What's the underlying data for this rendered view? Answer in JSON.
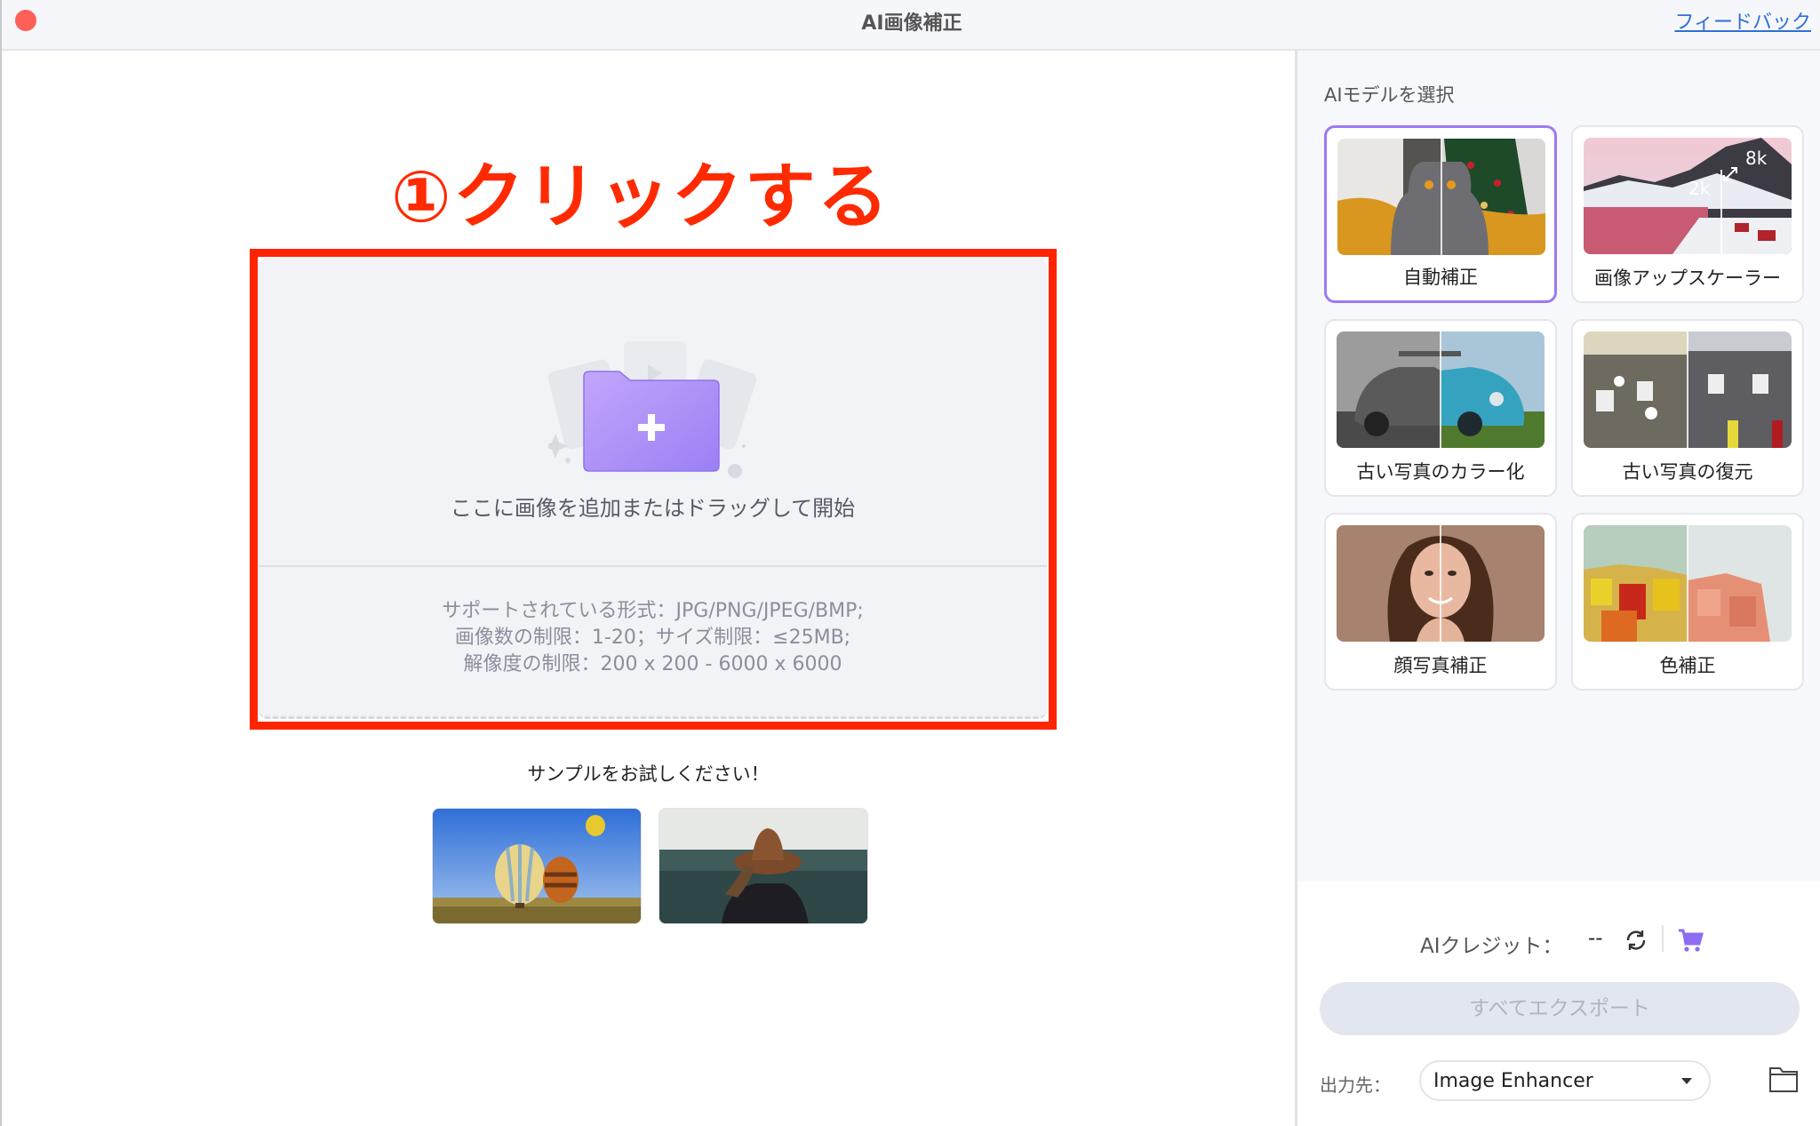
{
  "window": {
    "title": "AI画像補正",
    "feedback_link": "フィードバック",
    "close_button_color": "#fe5f57"
  },
  "annotation": {
    "text": "①クリックする",
    "color": "#ff2a00"
  },
  "dropzone": {
    "prompt": "ここに画像を追加またはドラッグして開始",
    "icon": "folder-plus-icon",
    "specs": [
      "サポートされている形式：JPG/PNG/JPEG/BMP;",
      "画像数の制限：1-20；サイズ制限：≤25MB;",
      "解像度の制限：200 x 200 - 6000 x 6000"
    ]
  },
  "samples": {
    "title": "サンプルをお試しください！",
    "items": [
      {
        "name": "hot-air-balloons"
      },
      {
        "name": "woman-in-hat-forest"
      }
    ]
  },
  "sidebar": {
    "model_label": "AIモデルを選択",
    "models": [
      {
        "label": "自動補正",
        "selected": true
      },
      {
        "label": "画像アップスケーラー",
        "selected": false,
        "badge_low": "2k",
        "badge_high": "8k"
      },
      {
        "label": "古い写真のカラー化",
        "selected": false
      },
      {
        "label": "古い写真の復元",
        "selected": false
      },
      {
        "label": "顔写真補正",
        "selected": false
      },
      {
        "label": "色補正",
        "selected": false
      }
    ],
    "credits_label": "AIクレジット：",
    "credits_value": "--",
    "export_button": "すべてエクスポート",
    "output_label": "出力先：",
    "output_value": "Image Enhancer",
    "accent_color": "#9c79f2"
  }
}
